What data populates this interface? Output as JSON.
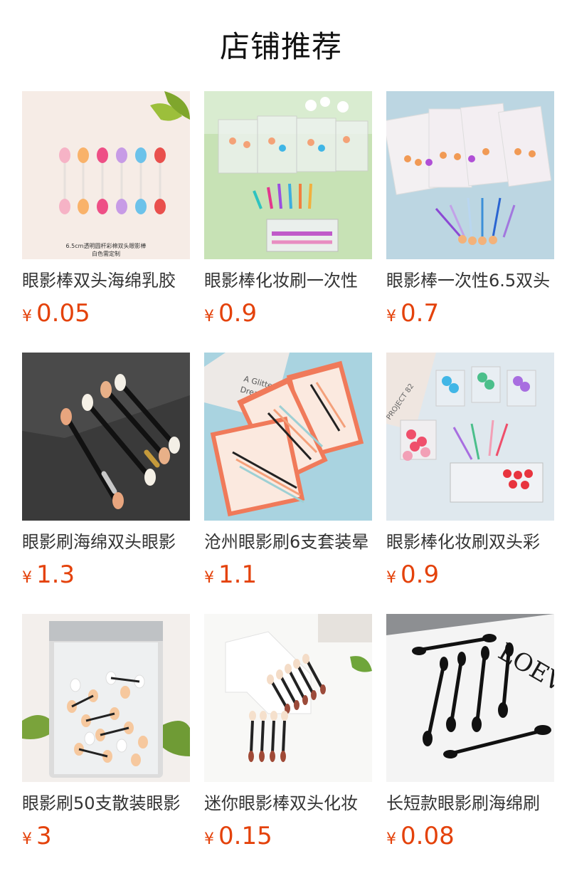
{
  "section": {
    "title": "店铺推荐"
  },
  "products": [
    {
      "name": "眼影棒双头海绵乳胶",
      "currency": "¥",
      "price": "0.05",
      "image_text": [
        "6.5cm透明圆杆彩棉双头眼影棒",
        "白色需定制"
      ]
    },
    {
      "name": "眼影棒化妆刷一次性",
      "currency": "¥",
      "price": "0.9"
    },
    {
      "name": "眼影棒一次性6.5双头",
      "currency": "¥",
      "price": "0.7"
    },
    {
      "name": "眼影刷海绵双头眼影",
      "currency": "¥",
      "price": "1.3"
    },
    {
      "name": "沧州眼影刷6支套装晕",
      "currency": "¥",
      "price": "1.1",
      "image_text": [
        "A Glitter",
        "Dream"
      ]
    },
    {
      "name": "眼影棒化妆刷双头彩",
      "currency": "¥",
      "price": "0.9",
      "image_text": [
        "PROJECT 82"
      ]
    },
    {
      "name": "眼影刷50支散装眼影",
      "currency": "¥",
      "price": "3"
    },
    {
      "name": "迷你眼影棒双头化妆",
      "currency": "¥",
      "price": "0.15"
    },
    {
      "name": "长短款眼影刷海绵刷",
      "currency": "¥",
      "price": "0.08",
      "image_text": [
        "LOEV"
      ]
    }
  ]
}
